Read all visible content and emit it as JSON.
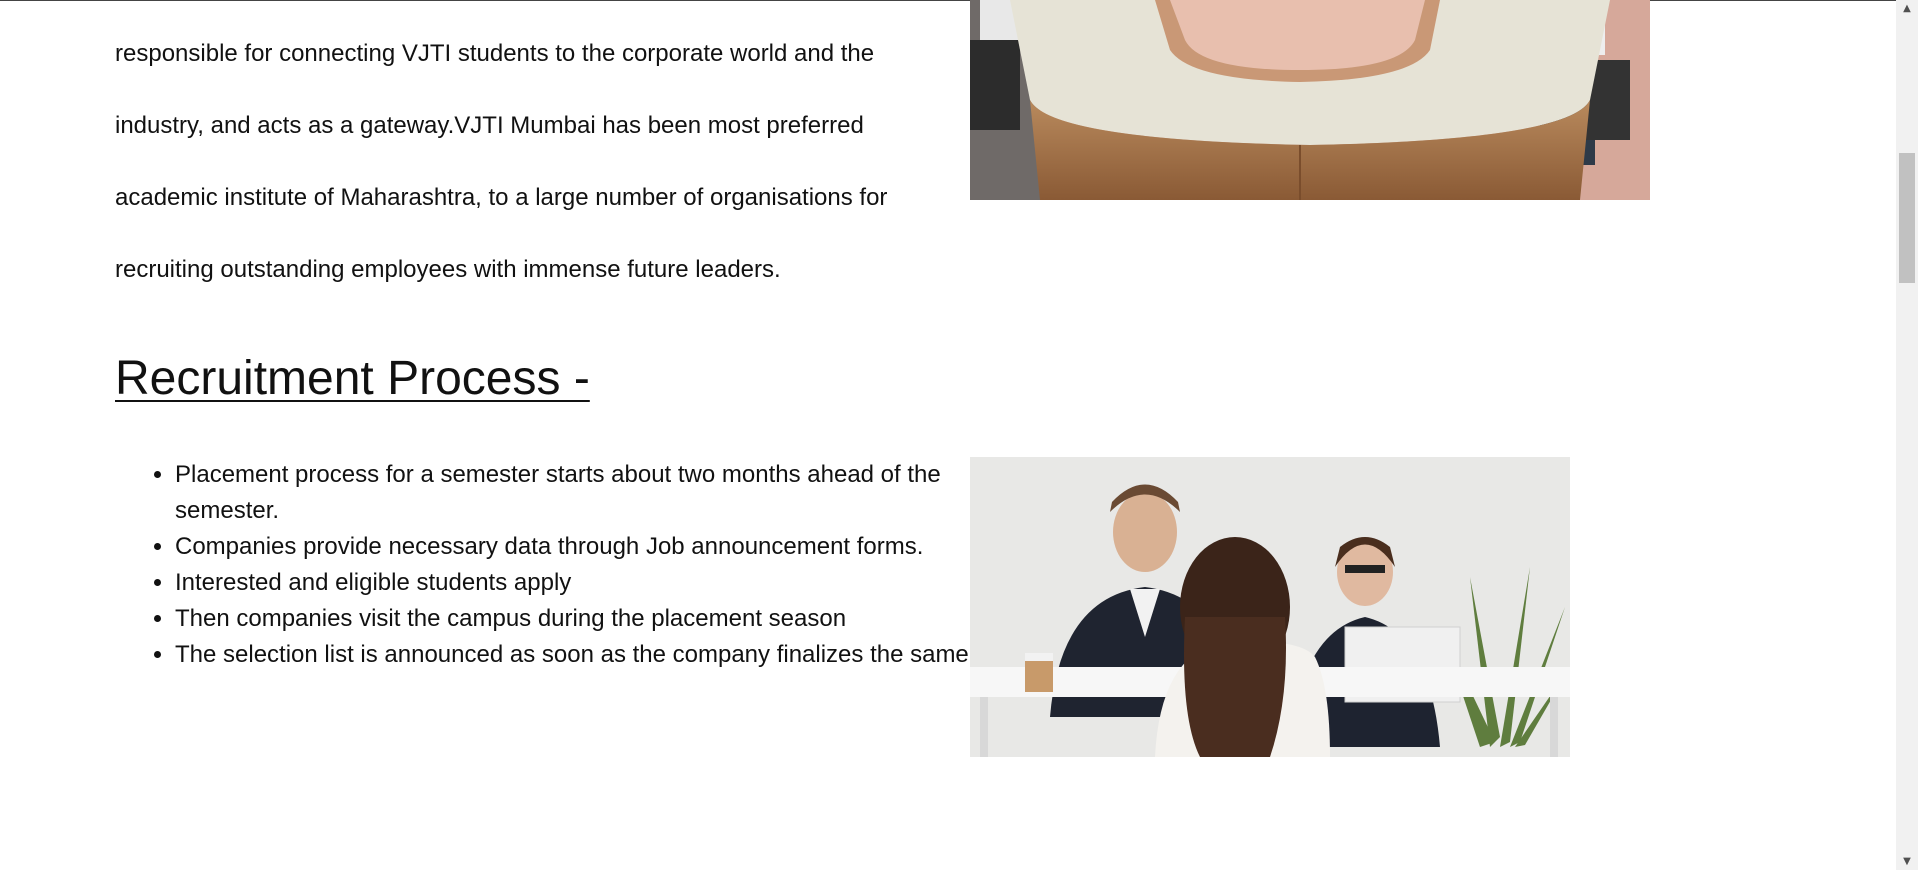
{
  "intro": {
    "lines": [
      "responsible for connecting VJTI students to the corporate world and the",
      "industry, and acts as a gateway.VJTI Mumbai has been most preferred",
      "academic institute of Maharashtra, to a large number of organisations for",
      "recruiting outstanding employees with immense future leaders."
    ]
  },
  "recruitment": {
    "heading": "Recruitment Process -",
    "steps": [
      "Placement process for a semester starts about two months ahead of the semester.",
      "Companies provide necessary data through Job announcement forms.",
      "Interested and eligible students apply",
      "Then companies visit the campus during the placement season",
      "The selection list is announced as soon as the company finalizes the same."
    ]
  },
  "images": {
    "boardroom": "conference-table-photo",
    "interview": "job-interview-photo"
  },
  "scrollbar": {
    "up_icon": "▲",
    "down_icon": "▼"
  }
}
